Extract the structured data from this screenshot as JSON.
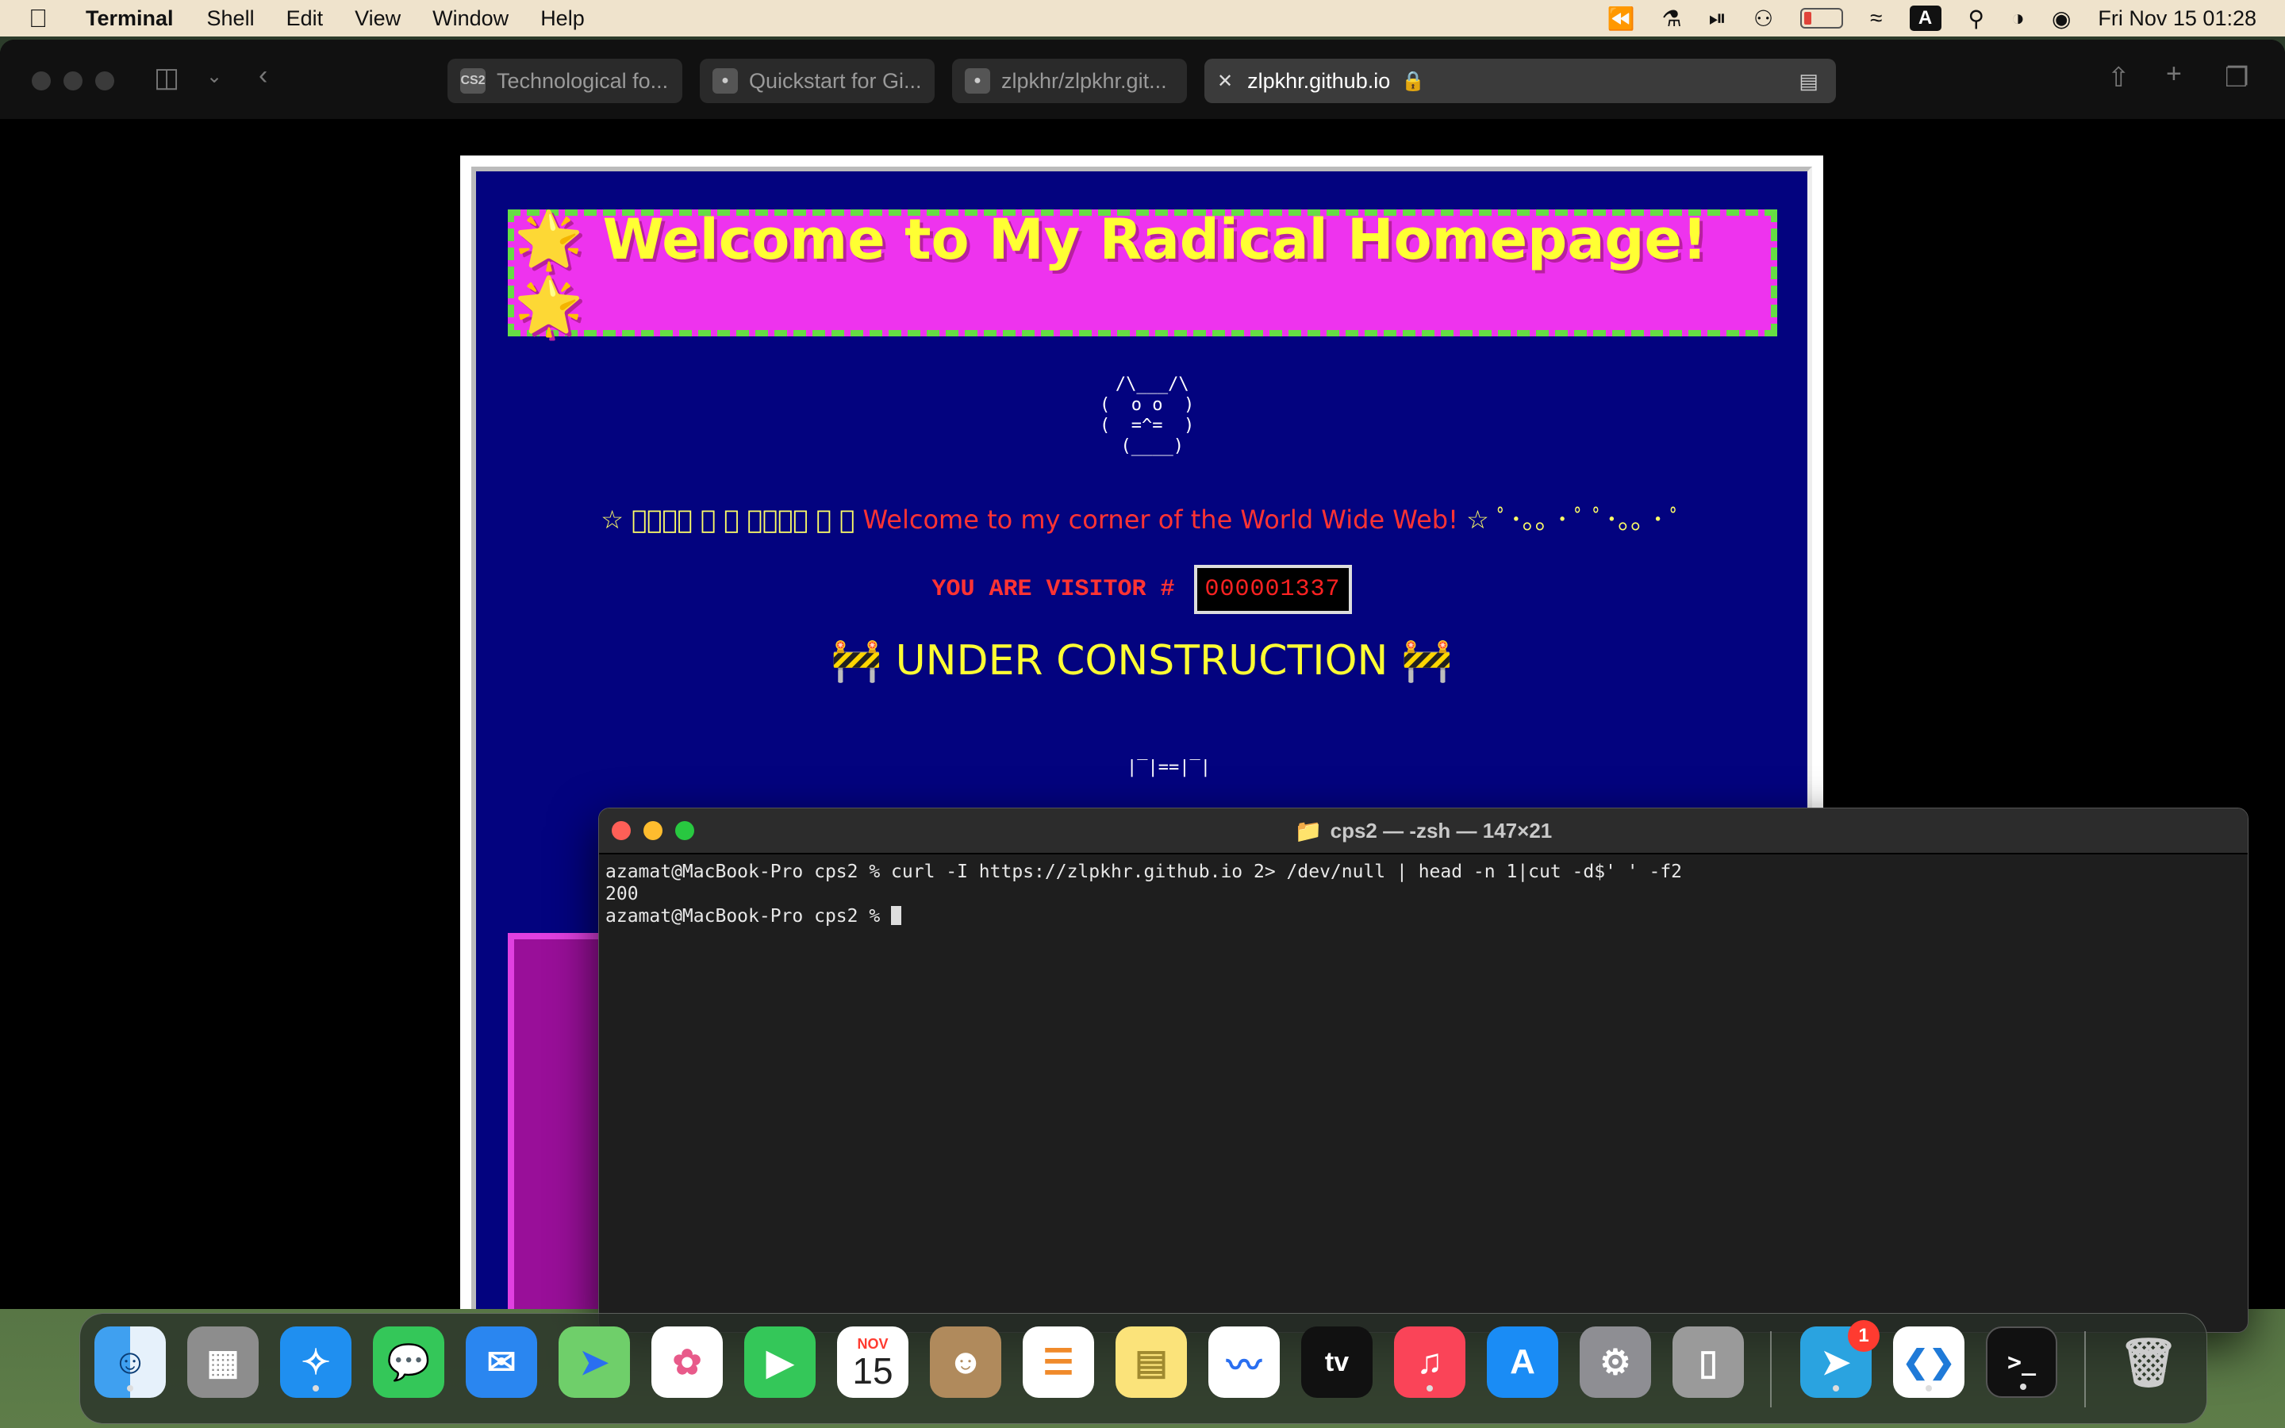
{
  "menubar": {
    "apple_icon": "apple-logo",
    "app_name": "Terminal",
    "menus": [
      "Shell",
      "Edit",
      "View",
      "Window",
      "Help"
    ],
    "input_source": "A",
    "datetime": "Fri Nov 15  01:28"
  },
  "browser": {
    "tabs": [
      {
        "title": "Technological fo...",
        "favicon": "CS2"
      },
      {
        "title": "Quickstart for Gi...",
        "favicon": "github-icon"
      },
      {
        "title": "zlpkhr/zlpkhr.git...",
        "favicon": "github-icon"
      },
      {
        "title": "zlpkhr.github.io",
        "favicon": "close-icon",
        "active": true
      }
    ]
  },
  "webpage": {
    "banner_title": "🌟 Welcome to My Radical Homepage! 🌟",
    "cat_art": "  /\\___/\\\n (  o o  )\n (  =^=  )\n  (____)",
    "stars_left": "☆ ﾟ･｡｡ ･ ﾟ ﾟ･｡｡ ･ ﾟ",
    "welcome_text": "Welcome to my corner of the World Wide Web!",
    "stars_right": "☆ ﾟ･｡｡ ･ ﾟ ﾟ･｡｡ ･ ﾟ",
    "visitor_label": "YOU ARE VISITOR #",
    "visitor_count": "000001337",
    "under_construction": "🚧 UNDER CONSTRUCTION 🚧",
    "construction_art": "|‾|==|‾|"
  },
  "terminal": {
    "title": "cps2 — -zsh — 147×21",
    "lines": [
      "azamat@MacBook-Pro cps2 % curl -I https://zlpkhr.github.io 2> /dev/null | head -n 1|cut -d$' ' -f2",
      "200",
      "azamat@MacBook-Pro cps2 % "
    ]
  },
  "dock": {
    "apps": [
      {
        "name": "Finder",
        "glyph": "☺"
      },
      {
        "name": "Launchpad",
        "glyph": "▦"
      },
      {
        "name": "Safari",
        "glyph": "✧"
      },
      {
        "name": "Messages",
        "glyph": "💬"
      },
      {
        "name": "Mail",
        "glyph": "✉"
      },
      {
        "name": "Maps",
        "glyph": "➤"
      },
      {
        "name": "Photos",
        "glyph": "✿"
      },
      {
        "name": "FaceTime",
        "glyph": "▶"
      },
      {
        "name": "Calendar",
        "month": "NOV",
        "day": "15"
      },
      {
        "name": "Contacts",
        "glyph": "☻"
      },
      {
        "name": "Reminders",
        "glyph": "☰"
      },
      {
        "name": "Notes",
        "glyph": "▤"
      },
      {
        "name": "Freeform",
        "glyph": "〰"
      },
      {
        "name": "TV",
        "glyph": "tv"
      },
      {
        "name": "Music",
        "glyph": "♫"
      },
      {
        "name": "App Store",
        "glyph": "A"
      },
      {
        "name": "System Settings",
        "glyph": "⚙"
      },
      {
        "name": "iPhone Mirroring",
        "glyph": "▯"
      },
      {
        "name": "Telegram",
        "glyph": "➤",
        "badge": "1"
      },
      {
        "name": "Visual Studio Code",
        "glyph": "❮❯"
      },
      {
        "name": "Terminal",
        "glyph": ">_"
      },
      {
        "name": "Trash",
        "glyph": "🗑"
      }
    ]
  },
  "colors": {
    "menubar": "#efe3cc",
    "page_bg": "#03037f",
    "banner_bg": "#ee33ee",
    "banner_border": "#66dd44",
    "banner_text": "#ffff33",
    "counter_text": "#ff2222",
    "terminal_bg": "#1e1e1e"
  }
}
